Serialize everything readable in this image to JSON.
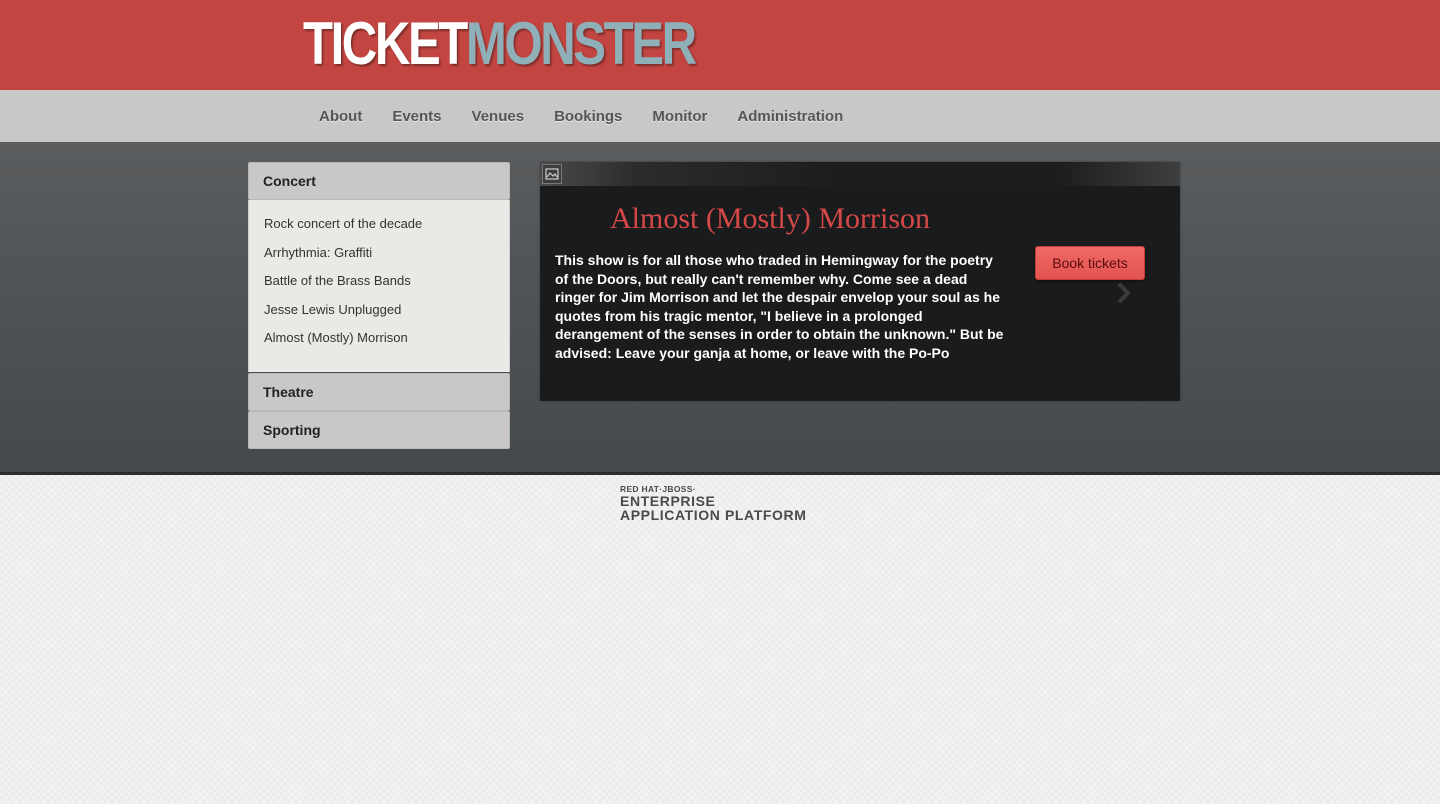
{
  "header": {
    "logo_part1": "TICKET",
    "logo_part2": "MONSTER",
    "logo_colors": {
      "ticket": "#ffffff",
      "monster": "#8fb0b8"
    },
    "background_color": "#c24541"
  },
  "nav": {
    "items": [
      {
        "label": "About"
      },
      {
        "label": "Events"
      },
      {
        "label": "Venues"
      },
      {
        "label": "Bookings"
      },
      {
        "label": "Monitor"
      },
      {
        "label": "Administration"
      }
    ]
  },
  "sidebar": {
    "sections": [
      {
        "title": "Concert",
        "expanded": true,
        "items": [
          {
            "label": "Rock concert of the decade"
          },
          {
            "label": "Arrhythmia: Graffiti"
          },
          {
            "label": "Battle of the Brass Bands"
          },
          {
            "label": "Jesse Lewis Unplugged"
          },
          {
            "label": "Almost (Mostly) Morrison"
          }
        ]
      },
      {
        "title": "Theatre",
        "expanded": false
      },
      {
        "title": "Sporting",
        "expanded": false
      }
    ]
  },
  "event": {
    "image_icon": "broken-image-icon",
    "title": "Almost (Mostly) Morrison",
    "description": "This show is for all those who traded in Hemingway for the poetry of the Doors, but really can't remember why. Come see a dead ringer for Jim Morrison and let the despair envelop your soul as he quotes from his tragic mentor, \"I believe in a prolonged derangement of the senses in order to obtain the unknown.\" But be advised: Leave your ganja at home, or leave with the Po-Po",
    "book_button_label": "Book tickets",
    "next_icon": "chevron-right-icon",
    "accent_color": "#d54848"
  },
  "footer": {
    "brand_line1": "RED HAT·JBOSS·",
    "brand_line2": "ENTERPRISE",
    "brand_line3": "APPLICATION PLATFORM"
  }
}
